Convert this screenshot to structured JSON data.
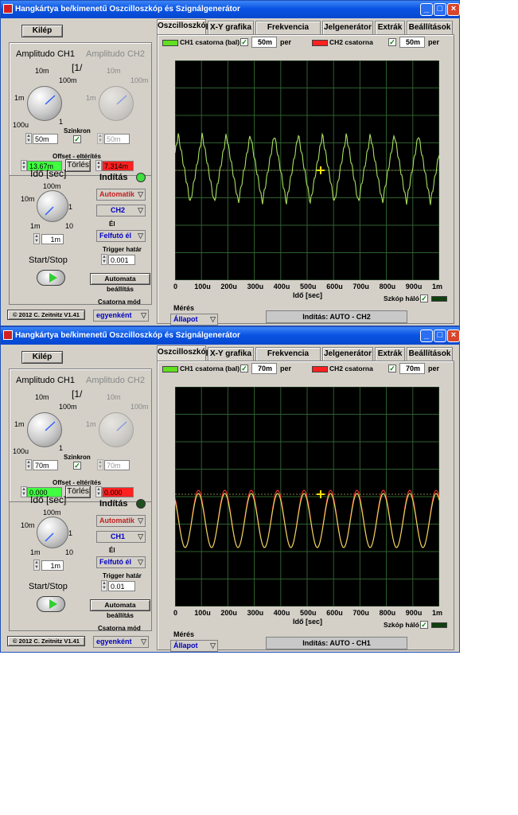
{
  "windows": [
    {
      "title": "Hangkártya be/kimenetű Oszcilloszkóp és Szignálgenerátor",
      "kilep": "Kilép",
      "ampl_ch1": "Amplitudo CH1",
      "ampl_ch2": "Amplitudo CH2",
      "unit_hint": "[1/",
      "knob_ticks": {
        "t10m": "10m",
        "t100m": "100m",
        "t1m": "1m",
        "t100u": "100u",
        "t1": "1"
      },
      "ch1_value": "50m",
      "ch2_value": "50m",
      "szinkron": "Szinkron",
      "offset_label": "Offset - eltérítés",
      "offset_ch1": "13.67m",
      "offset_ch2": "7.314m",
      "torles": "Törlés",
      "ido_label": "Idő [sec]",
      "time_ticks": {
        "t100m": "100m",
        "t10m": "10m",
        "t1": "1",
        "t1m": "1m",
        "t10": "10"
      },
      "time_value": "1m",
      "start_stop": "Start/Stop",
      "inditas": "Indítás",
      "mode": "Automatik",
      "channel": "CH2",
      "el_label": "Él",
      "edge": "Felfutó él",
      "trigger_label": "Trigger határ",
      "trigger_value": "0.001",
      "auto_btn": "Automata beállítás",
      "csatorna_mod": "Csatorna mód",
      "csatorna_value": "egyenként",
      "copyright": "© 2012  C. Zeitnitz V1.41",
      "tabs": [
        "Oszcilloszkóp",
        "X-Y grafika",
        "Frekvencia analiz.",
        "Jelgenerátor",
        "Extrák",
        "Beállítások"
      ],
      "ch1_legend": "CH1 csatorna (bal)",
      "ch1_per_value": "50m",
      "per": "per",
      "ch2_legend": "CH2 csatorna",
      "ch2_per_value": "50m",
      "x_ticks": [
        "0",
        "100u",
        "200u",
        "300u",
        "400u",
        "500u",
        "600u",
        "700u",
        "800u",
        "900u",
        "1m"
      ],
      "x_label": "Idő [sec]",
      "grid_label": "Szkóp háló",
      "meres": "Mérés",
      "allapot": "Állapot",
      "status": "Indítás: AUTO - CH2",
      "led_color": "#40e040"
    },
    {
      "title": "Hangkártya be/kimenetű Oszcilloszkóp és Szignálgenerátor",
      "kilep": "Kilép",
      "ampl_ch1": "Amplitudo CH1",
      "ampl_ch2": "Amplitudo CH2",
      "unit_hint": "[1/",
      "knob_ticks": {
        "t10m": "10m",
        "t100m": "100m",
        "t1m": "1m",
        "t100u": "100u",
        "t1": "1"
      },
      "ch1_value": "70m",
      "ch2_value": "70m",
      "szinkron": "Szinkron",
      "offset_label": "Offset - eltérítés",
      "offset_ch1": "0.000",
      "offset_ch2": "0.000",
      "torles": "Törlés",
      "ido_label": "Idő [sec]",
      "time_ticks": {
        "t100m": "100m",
        "t10m": "10m",
        "t1": "1",
        "t1m": "1m",
        "t10": "10"
      },
      "time_value": "1m",
      "start_stop": "Start/Stop",
      "inditas": "Indítás",
      "mode": "Automatik",
      "channel": "CH1",
      "el_label": "Él",
      "edge": "Felfutó él",
      "trigger_label": "Trigger határ",
      "trigger_value": "0.01",
      "auto_btn": "Automata beállítás",
      "csatorna_mod": "Csatorna mód",
      "csatorna_value": "egyenként",
      "copyright": "© 2012  C. Zeitnitz V1.41",
      "tabs": [
        "Oszcilloszkóp",
        "X-Y grafika",
        "Frekvencia analiz.",
        "Jelgenerátor",
        "Extrák",
        "Beállítások"
      ],
      "ch1_legend": "CH1 csatorna (bal)",
      "ch1_per_value": "70m",
      "per": "per",
      "ch2_legend": "CH2 csatorna",
      "ch2_per_value": "70m",
      "x_ticks": [
        "0",
        "100u",
        "200u",
        "300u",
        "400u",
        "500u",
        "600u",
        "700u",
        "800u",
        "900u",
        "1m"
      ],
      "x_label": "Idő [sec]",
      "grid_label": "Szkóp háló",
      "meres": "Mérés",
      "allapot": "Állapot",
      "status": "Indítás: AUTO - CH1",
      "led_color": "#205020"
    }
  ],
  "colors": {
    "ch1": "#a8e060",
    "ch2": "#ff3030",
    "offset_green": "#40ff40",
    "offset_red": "#ff2020",
    "grid": "#2f5f2f",
    "titlebar": "#0a54e3"
  }
}
